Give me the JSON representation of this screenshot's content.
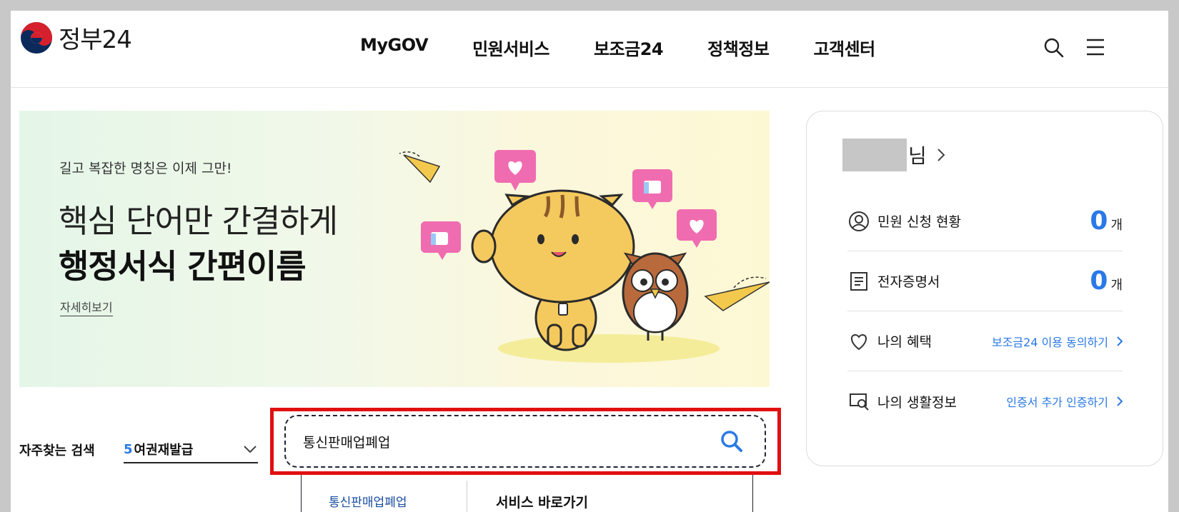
{
  "header": {
    "logo_text": "정부24",
    "nav": [
      "MyGOV",
      "민원서비스",
      "보조금24",
      "정책정보",
      "고객센터"
    ]
  },
  "banner": {
    "subtitle": "길고 복잡한 명칭은 이제 그만!",
    "line1": "핵심 단어만 간결하게",
    "line2": "행정서식 간편이름",
    "link": "자세히보기"
  },
  "user_card": {
    "name_suffix": "님",
    "rows": [
      {
        "label": "민원 신청 현황",
        "value": "0",
        "unit": "개",
        "icon": "person-circle-icon"
      },
      {
        "label": "전자증명서",
        "value": "0",
        "unit": "개",
        "icon": "document-icon"
      },
      {
        "label": "나의 혜택",
        "link": "보조금24 이용 동의하기",
        "icon": "heart-icon"
      },
      {
        "label": "나의 생활정보",
        "link": "인증서 추가 인증하기",
        "icon": "monitor-search-icon"
      }
    ]
  },
  "search": {
    "frequent_label": "자주찾는 검색",
    "frequent_rank": "5",
    "frequent_text": "여권재발급",
    "input_value": "통신판매업폐업",
    "suggestion": "통신판매업폐업",
    "shortcut_label": "서비스 바로가기"
  },
  "colors": {
    "accent": "#2a79e7",
    "highlight": "#e01010"
  }
}
